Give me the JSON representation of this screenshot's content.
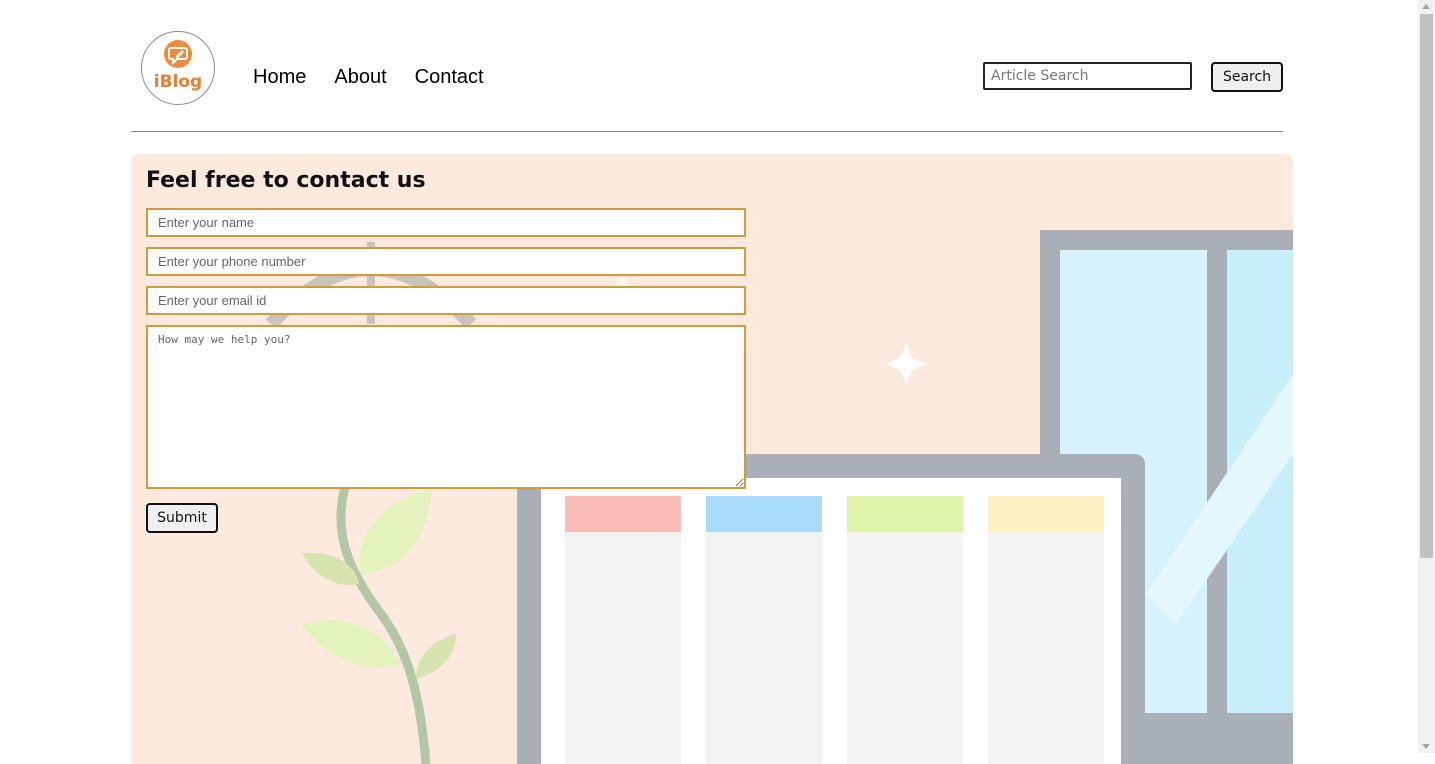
{
  "header": {
    "logo_text": "iBlog",
    "nav": [
      {
        "label": "Home"
      },
      {
        "label": "About"
      },
      {
        "label": "Contact"
      }
    ],
    "search": {
      "placeholder": "Article Search",
      "button_label": "Search"
    }
  },
  "contact": {
    "heading": "Feel free to contact us",
    "name_placeholder": "Enter your name",
    "phone_placeholder": "Enter your phone number",
    "email_placeholder": "Enter your email id",
    "message_placeholder": "How may we help you?",
    "submit_label": "Submit"
  },
  "colors": {
    "hero_background": "#fde9dd",
    "field_border": "#d49a3e",
    "logo_accent": "#f08a3c"
  },
  "icons": {
    "logo": "chat-bubble-pencil-icon",
    "decor": [
      "sparkle-icon",
      "plant-illustration",
      "laptop-kanban-illustration",
      "window-illustration"
    ]
  }
}
